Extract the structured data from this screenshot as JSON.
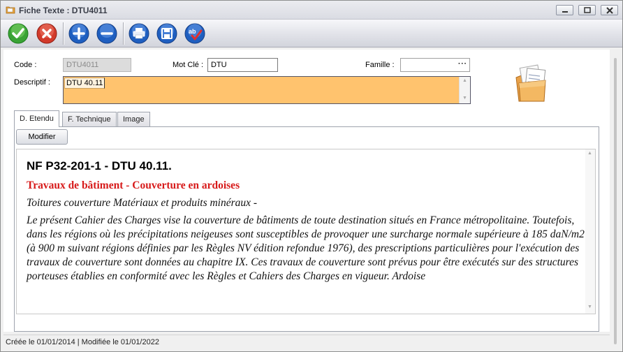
{
  "window": {
    "title": "Fiche Texte : DTU4011",
    "controls": [
      "minimize",
      "maximize",
      "close"
    ]
  },
  "toolbar": {
    "buttons": [
      {
        "name": "validate",
        "icon": "check-icon",
        "color": "#3aa335"
      },
      {
        "name": "cancel",
        "icon": "x-icon",
        "color": "#d23a2b"
      },
      {
        "name": "add",
        "icon": "plus-icon",
        "color": "#1f5fc0"
      },
      {
        "name": "remove",
        "icon": "minus-icon",
        "color": "#1f5fc0"
      },
      {
        "name": "print",
        "icon": "printer-icon",
        "color": "#1f5fc0"
      },
      {
        "name": "save",
        "icon": "floppy-icon",
        "color": "#1f5fc0"
      },
      {
        "name": "spellcheck",
        "icon": "spellcheck-icon",
        "color": "#1f5fc0"
      }
    ]
  },
  "form": {
    "code_label": "Code :",
    "code_value": "DTU4011",
    "motcle_label": "Mot Clé :",
    "motcle_value": "DTU",
    "famille_label": "Famille :",
    "famille_value": "",
    "famille_button": "···",
    "descriptif_label": "Descriptif :",
    "descriptif_value": "DTU 40.11",
    "descriptif_bg": "#ffc36e"
  },
  "tabs": [
    {
      "label": "D. Etendu",
      "active": true
    },
    {
      "label": "F. Technique",
      "active": false
    },
    {
      "label": "Image",
      "active": false
    }
  ],
  "panel": {
    "modify_button": "Modifier",
    "heading": "NF P32-201-1 - DTU 40.11.",
    "subtitle": "Travaux de bâtiment - Couverture en ardoises",
    "subtitle_color": "#d71a1a",
    "line1": "Toitures couverture Matériaux et produits minéraux -",
    "para": "Le présent Cahier des Charges vise la couverture de bâtiments de toute destination situés en France métropolitaine. Toutefois, dans les régions où les précipitations neigeuses sont susceptibles de provoquer une surcharge normale supérieure à 185 daN/m2 (à 900 m suivant régions définies par les Règles NV édition refondue 1976), des prescriptions particulières pour l'exécution des travaux de couverture sont données au chapitre IX. Ces travaux de couverture sont prévus pour être exécutés sur des structures porteuses établies en conformité avec les Règles et Cahiers des Charges en vigueur. Ardoise"
  },
  "status": {
    "text": "Créée le 01/01/2014 | Modifiée le 01/01/2022"
  }
}
